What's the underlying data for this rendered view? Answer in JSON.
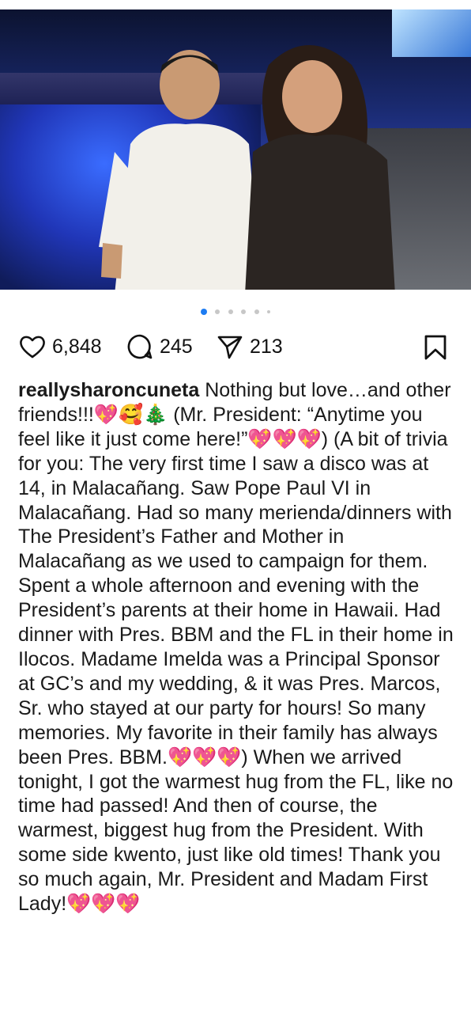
{
  "post": {
    "image_alt": "photo",
    "carousel": {
      "current": 1,
      "total": 6
    },
    "likes": "6,848",
    "comments": "245",
    "shares": "213",
    "username": "reallysharoncuneta",
    "caption": " Nothing but love…and other friends!!!💖🥰🎄 (Mr. President: “Anytime you feel like it just come here!”💖💖💖) (A bit of trivia for you: The very first time I saw a disco was at 14, in Malacañang. Saw Pope Paul VI in Malacañang. Had so many merienda/dinners with The President’s Father and Mother in Malacañang as we used to campaign for them. Spent a whole afternoon and evening with the President’s parents at their home in Hawaii. Had dinner with Pres. BBM and the FL in their home in Ilocos. Madame Imelda was a Principal Sponsor at GC’s and my wedding, & it was Pres. Marcos, Sr. who stayed at our party for hours! So many memories. My favorite in their family has always been Pres. BBM.💖💖💖) When we arrived tonight, I got the warmest hug from the FL, like no time had passed! And then of course, the warmest, biggest hug from the President. With some side kwento, just like old times! Thank you so much again, Mr. President and Madam First Lady!💖💖💖"
  },
  "icons": [
    "heart-icon",
    "comment-icon",
    "share-icon",
    "bookmark-icon"
  ],
  "colors": {
    "accent": "#1d7cf2",
    "text": "#111111"
  }
}
